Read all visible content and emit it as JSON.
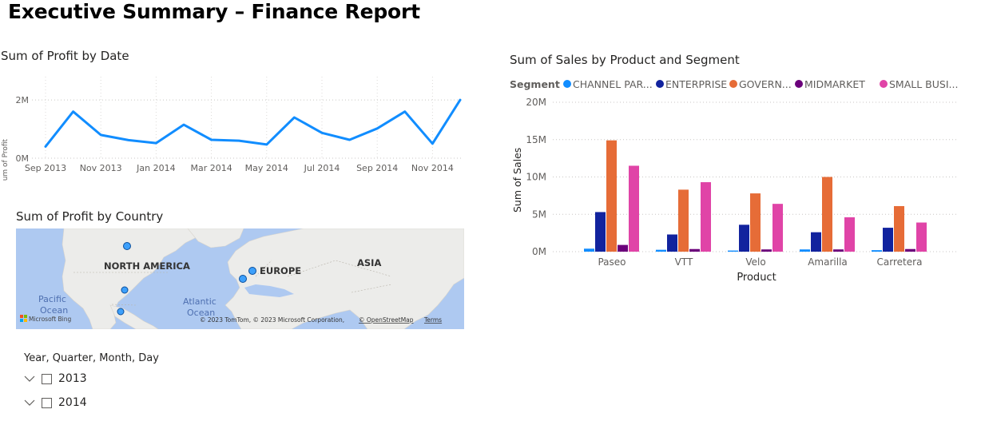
{
  "page": {
    "title": "Executive Summary – Finance Report"
  },
  "colors": {
    "line": "#118dff",
    "channel_partners": "#118dff",
    "enterprise": "#12239e",
    "government": "#e66c37",
    "midmarket": "#6b007b",
    "small_business": "#e044a7",
    "map_water": "#aec9f1",
    "map_land": "#ececea"
  },
  "line_chart": {
    "title": "Sum of Profit by Date",
    "ylabel": "Sum of Profit",
    "y_ticks": [
      "0M",
      "2M"
    ],
    "x_ticks": [
      "Sep 2013",
      "Nov 2013",
      "Jan 2014",
      "Mar 2014",
      "May 2014",
      "Jul 2014",
      "Sep 2014",
      "Nov 2014"
    ]
  },
  "map": {
    "title": "Sum of Profit by Country",
    "labels": {
      "north_america": "NORTH AMERICA",
      "europe": "EUROPE",
      "asia": "ASIA",
      "pacific": "Pacific",
      "pacific2": "Ocean",
      "atlantic": "Atlantic",
      "atlantic2": "Ocean"
    },
    "bing": "Microsoft Bing",
    "copyright": "© 2023 TomTom, © 2023 Microsoft Corporation,",
    "osm": "© OpenStreetMap",
    "terms": "Terms"
  },
  "slicer": {
    "title": "Year, Quarter, Month, Day",
    "items": [
      {
        "label": "2013"
      },
      {
        "label": "2014"
      }
    ]
  },
  "bar_legend": {
    "title": "Segment",
    "items": [
      "CHANNEL PAR...",
      "ENTERPRISE",
      "GOVERN...",
      "MIDMARKET",
      "SMALL BUSI..."
    ]
  },
  "chart_data": [
    {
      "type": "line",
      "title": "Sum of Profit by Date",
      "xlabel": "",
      "ylabel": "Sum of Profit",
      "x": [
        "Sep 2013",
        "Oct 2013",
        "Nov 2013",
        "Dec 2013",
        "Jan 2014",
        "Feb 2014",
        "Mar 2014",
        "Apr 2014",
        "May 2014",
        "Jun 2014",
        "Jul 2014",
        "Aug 2014",
        "Sep 2014",
        "Oct 2014",
        "Nov 2014",
        "Dec 2014"
      ],
      "series": [
        {
          "values": [
            0.4,
            1.6,
            0.8,
            0.62,
            0.52,
            1.15,
            0.63,
            0.6,
            0.47,
            1.4,
            0.87,
            0.63,
            1.02,
            1.6,
            0.5,
            2.0
          ]
        }
      ],
      "y_unit": "M",
      "ylim": [
        0,
        2.8
      ],
      "grid": true
    },
    {
      "type": "bar",
      "title": "Sum of Sales by Product and Segment",
      "xlabel": "Product",
      "ylabel": "Sum of Sales",
      "legend_title": "Segment",
      "legend_position": "top-left",
      "categories": [
        "Paseo",
        "VTT",
        "Velo",
        "Amarilla",
        "Carretera"
      ],
      "series": [
        {
          "name": "CHANNEL PARTNERS",
          "values": [
            0.4,
            0.25,
            0.15,
            0.3,
            0.2
          ]
        },
        {
          "name": "ENTERPRISE",
          "values": [
            5.3,
            2.3,
            3.6,
            2.6,
            3.2
          ]
        },
        {
          "name": "GOVERNMENT",
          "values": [
            14.9,
            8.3,
            7.8,
            10.0,
            6.1
          ]
        },
        {
          "name": "MIDMARKET",
          "values": [
            0.9,
            0.35,
            0.3,
            0.3,
            0.35
          ]
        },
        {
          "name": "SMALL BUSINESS",
          "values": [
            11.5,
            9.3,
            6.4,
            4.6,
            3.9
          ]
        }
      ],
      "y_unit": "M",
      "y_ticks": [
        "0M",
        "5M",
        "10M",
        "15M",
        "20M"
      ],
      "ylim": [
        0,
        20
      ],
      "grid": true
    }
  ]
}
